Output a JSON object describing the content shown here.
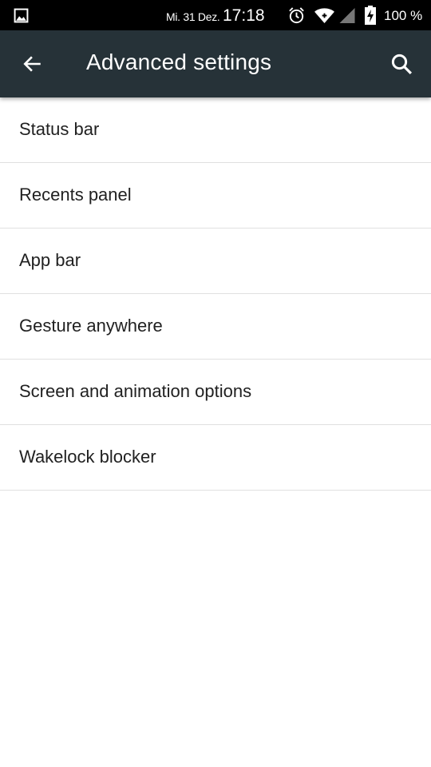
{
  "status_bar": {
    "date": "Mi. 31 Dez.",
    "time": "17:18",
    "battery": "100 %",
    "icons": [
      "gallery-icon",
      "alarm-icon",
      "wifi-icon",
      "cellular-signal-icon",
      "battery-charging-icon"
    ]
  },
  "app_bar": {
    "title": "Advanced settings",
    "back_icon": "arrow-back-icon",
    "search_icon": "search-icon",
    "background": "#263238"
  },
  "settings": {
    "items": [
      {
        "label": "Status bar"
      },
      {
        "label": "Recents panel"
      },
      {
        "label": "App bar"
      },
      {
        "label": "Gesture anywhere"
      },
      {
        "label": "Screen and animation options"
      },
      {
        "label": "Wakelock blocker"
      }
    ]
  }
}
